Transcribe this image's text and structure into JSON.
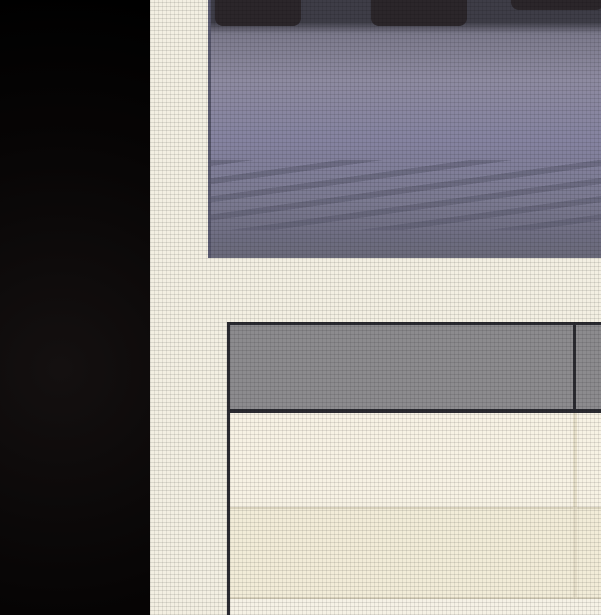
{
  "screen": {
    "photo": {
      "icon": "photo-thumbnail"
    },
    "table": {
      "header": {
        "cell": ""
      },
      "rows": [
        {
          "cell": ""
        },
        {
          "cell": ""
        }
      ]
    }
  },
  "colors": {
    "bezel": "#050404",
    "screen_bg": "#f3efe2",
    "table_header": "#8c8b8e",
    "table_border": "#2a2a30"
  }
}
